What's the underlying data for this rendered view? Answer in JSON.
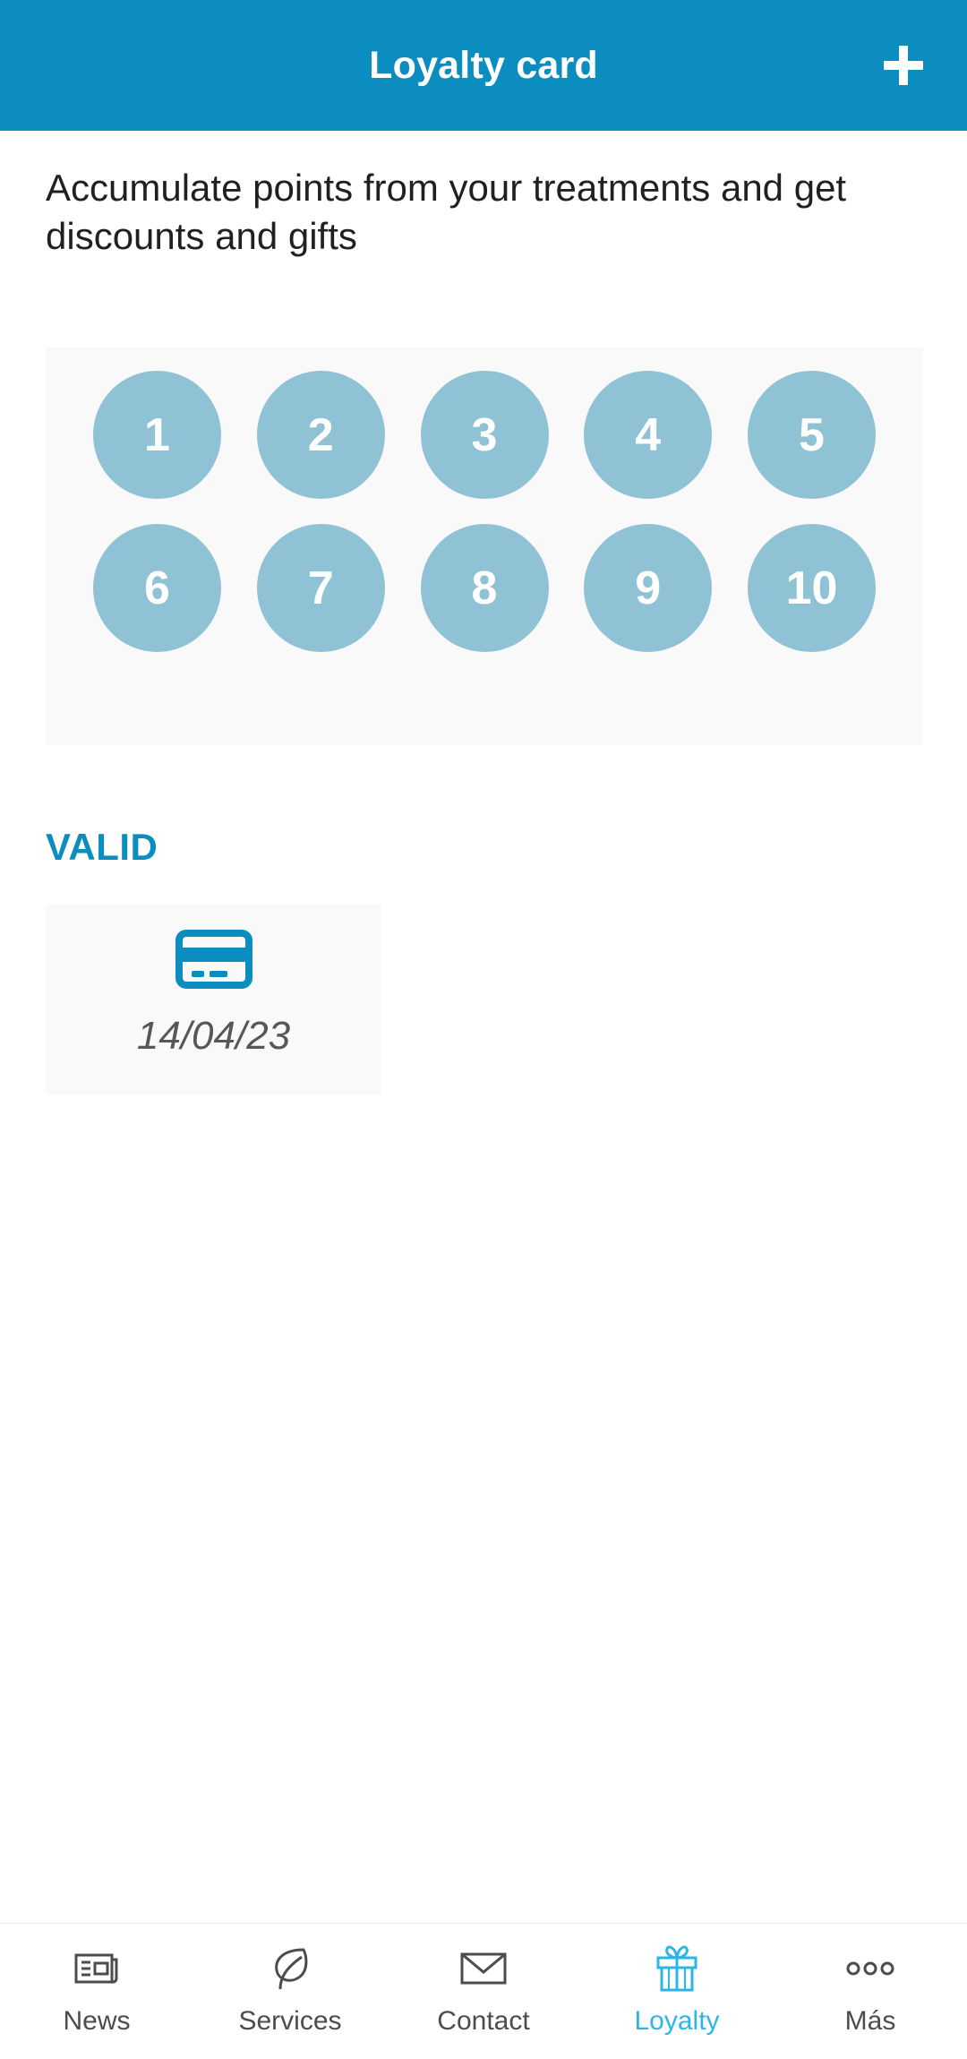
{
  "header": {
    "title": "Loyalty card",
    "add_icon": "plus-icon",
    "background_color": "#0b8ebf",
    "title_color": "#ffffff"
  },
  "main": {
    "intro_text": "Accumulate points from your treatments and get discounts and gifts",
    "points": {
      "row1": [
        "1",
        "2",
        "3",
        "4",
        "5"
      ],
      "row2": [
        "6",
        "7",
        "8",
        "9",
        "10"
      ],
      "circle_color": "#8ec2d4",
      "panel_color": "#f9f9f9",
      "number_color": "#ffffff"
    },
    "valid": {
      "section_title": "VALID",
      "title_color": "#0b8ebf",
      "card_icon": "credit-card-icon",
      "card_icon_color": "#0b8ebf",
      "date": "14/04/23",
      "date_color": "#575757",
      "tile_color": "#f9f9f9"
    }
  },
  "tabbar": {
    "active_color": "#2bb5e8",
    "inactive_color": "#4c4c4c",
    "items": [
      {
        "label": "News",
        "icon": "newspaper-icon",
        "active": false
      },
      {
        "label": "Services",
        "icon": "leaf-icon",
        "active": false
      },
      {
        "label": "Contact",
        "icon": "envelope-icon",
        "active": false
      },
      {
        "label": "Loyalty",
        "icon": "gift-icon",
        "active": true
      },
      {
        "label": "Más",
        "icon": "ellipsis-icon",
        "active": false
      }
    ]
  }
}
